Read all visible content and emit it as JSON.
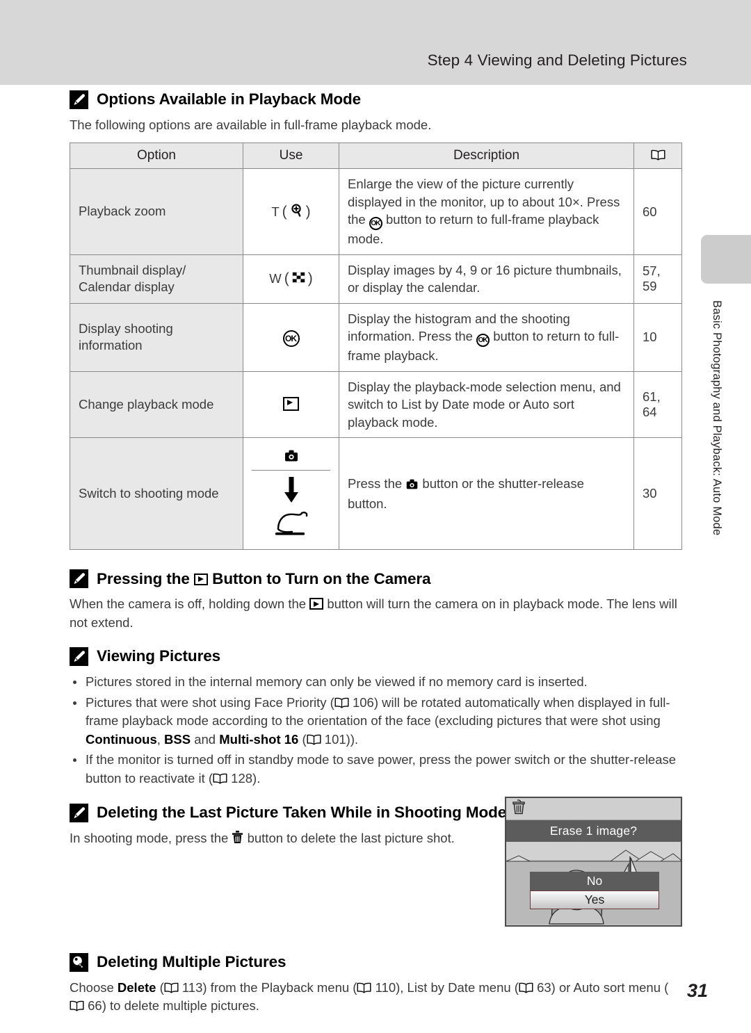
{
  "header": {
    "title": "Step 4 Viewing and Deleting Pictures"
  },
  "side_tab": {
    "label": "Basic Photography and Playback: Auto Mode"
  },
  "page_number": "31",
  "sections": {
    "options": {
      "icon": "pencil-note-icon",
      "title": "Options Available in Playback Mode",
      "intro": "The following options are available in full-frame playback mode."
    },
    "press_play": {
      "icon": "pencil-note-icon",
      "title_before": "Pressing the",
      "title_icon": "playback-button-icon",
      "title_after": "Button to Turn on the Camera",
      "body_before": "When the camera is off, holding down the",
      "body_icon": "playback-button-icon",
      "body_after": "button will turn the camera on in playback mode. The lens will not extend."
    },
    "viewing": {
      "icon": "pencil-note-icon",
      "title": "Viewing Pictures",
      "bullets": [
        {
          "parts": [
            {
              "t": "text",
              "v": "Pictures stored in the internal memory can only be viewed if no memory card is inserted."
            }
          ]
        },
        {
          "parts": [
            {
              "t": "text",
              "v": "Pictures that were shot using Face Priority ("
            },
            {
              "t": "icon",
              "v": "book-icon"
            },
            {
              "t": "text",
              "v": " 106) will be rotated automatically when displayed in full-frame playback mode according to the orientation of the face (excluding pictures that were shot using "
            },
            {
              "t": "bold",
              "v": "Continuous"
            },
            {
              "t": "text",
              "v": ", "
            },
            {
              "t": "bold",
              "v": "BSS"
            },
            {
              "t": "text",
              "v": " and "
            },
            {
              "t": "bold",
              "v": "Multi-shot 16"
            },
            {
              "t": "text",
              "v": " ("
            },
            {
              "t": "icon",
              "v": "book-icon"
            },
            {
              "t": "text",
              "v": " 101))."
            }
          ]
        },
        {
          "parts": [
            {
              "t": "text",
              "v": "If the monitor is turned off in standby mode to save power, press the power switch or the shutter-release button to reactivate it ("
            },
            {
              "t": "icon",
              "v": "book-icon"
            },
            {
              "t": "text",
              "v": " 128)."
            }
          ]
        }
      ]
    },
    "delete_last": {
      "icon": "pencil-note-icon",
      "title": "Deleting the Last Picture Taken While in Shooting Mode",
      "body_before": "In shooting mode, press the",
      "body_icon": "trash-icon",
      "body_after": "button to delete the last picture shot."
    },
    "delete_multiple": {
      "icon": "lightbulb-tip-icon",
      "title": "Deleting Multiple Pictures",
      "body": "Choose Delete ( 113) from the Playback menu ( 110), List by Date menu ( 63) or Auto sort menu ( 66) to delete multiple pictures.",
      "body_parts": [
        {
          "t": "text",
          "v": "Choose "
        },
        {
          "t": "bold",
          "v": "Delete"
        },
        {
          "t": "text",
          "v": " ("
        },
        {
          "t": "icon",
          "v": "book-icon"
        },
        {
          "t": "text",
          "v": " 113) from the Playback menu ("
        },
        {
          "t": "icon",
          "v": "book-icon"
        },
        {
          "t": "text",
          "v": " 110), List by Date menu ("
        },
        {
          "t": "icon",
          "v": "book-icon"
        },
        {
          "t": "text",
          "v": " 63) or Auto sort menu ("
        },
        {
          "t": "icon",
          "v": "book-icon"
        },
        {
          "t": "text",
          "v": " 66) to delete multiple pictures."
        }
      ]
    }
  },
  "table": {
    "headers": {
      "option": "Option",
      "use": "Use",
      "description": "Description",
      "page": "book-icon"
    },
    "rows": [
      {
        "option": "Playback zoom",
        "use_text": "T",
        "use_icon": "magnifier-icon",
        "use_parens": true,
        "description_parts": [
          {
            "t": "text",
            "v": "Enlarge the view of the picture currently displayed in the monitor, up to about 10×. Press the "
          },
          {
            "t": "icon",
            "v": "ok-button-icon"
          },
          {
            "t": "text",
            "v": " button to return to full-frame playback mode."
          }
        ],
        "page": "60"
      },
      {
        "option": "Thumbnail display/ Calendar display",
        "use_text": "W",
        "use_icon": "thumbnail-grid-icon",
        "use_parens": true,
        "description_parts": [
          {
            "t": "text",
            "v": "Display images by 4, 9 or 16 picture thumbnails, or display the calendar."
          }
        ],
        "page": "57, 59"
      },
      {
        "option": "Display shooting information",
        "use_text": "",
        "use_icon": "ok-button-icon",
        "use_parens": false,
        "description_parts": [
          {
            "t": "text",
            "v": "Display the histogram and the shooting information. Press the "
          },
          {
            "t": "icon",
            "v": "ok-button-icon"
          },
          {
            "t": "text",
            "v": " button to return to full-frame playback."
          }
        ],
        "page": "10"
      },
      {
        "option": "Change playback mode",
        "use_text": "",
        "use_icon": "playback-button-icon",
        "use_parens": false,
        "description_parts": [
          {
            "t": "text",
            "v": "Display the playback-mode selection menu, and switch to List by Date mode or Auto sort playback mode."
          }
        ],
        "page": "61, 64"
      },
      {
        "option": "Switch to shooting mode",
        "use_text": "",
        "use_icon": "camera-button-icon",
        "use_split": true,
        "use_split_icons": [
          "camera-button-icon",
          "down-arrow-icon",
          "shutter-release-illustration"
        ],
        "description_parts": [
          {
            "t": "text",
            "v": "Press the "
          },
          {
            "t": "icon",
            "v": "camera-button-icon"
          },
          {
            "t": "text",
            "v": " button or the shutter-release button."
          }
        ],
        "page": "30"
      }
    ]
  },
  "lcd": {
    "top_icon": "trash-icon",
    "title": "Erase 1 image?",
    "options": [
      {
        "label": "No",
        "selected": false
      },
      {
        "label": "Yes",
        "selected": true
      }
    ]
  }
}
